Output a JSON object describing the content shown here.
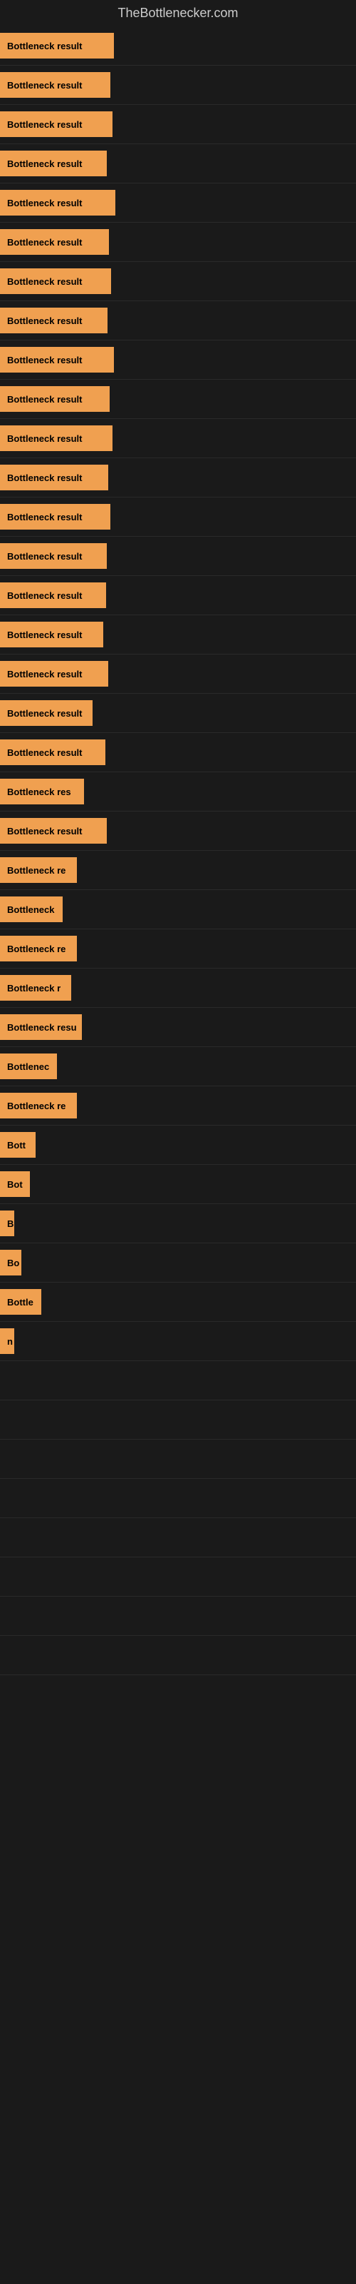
{
  "site": {
    "title": "TheBottlenecker.com"
  },
  "bars": [
    {
      "label": "Bottleneck result",
      "width": 160
    },
    {
      "label": "Bottleneck result",
      "width": 155
    },
    {
      "label": "Bottleneck result",
      "width": 158
    },
    {
      "label": "Bottleneck result",
      "width": 150
    },
    {
      "label": "Bottleneck result",
      "width": 162
    },
    {
      "label": "Bottleneck result",
      "width": 153
    },
    {
      "label": "Bottleneck result",
      "width": 156
    },
    {
      "label": "Bottleneck result",
      "width": 151
    },
    {
      "label": "Bottleneck result",
      "width": 160
    },
    {
      "label": "Bottleneck result",
      "width": 154
    },
    {
      "label": "Bottleneck result",
      "width": 158
    },
    {
      "label": "Bottleneck result",
      "width": 152
    },
    {
      "label": "Bottleneck result",
      "width": 155
    },
    {
      "label": "Bottleneck result",
      "width": 150
    },
    {
      "label": "Bottleneck result",
      "width": 149
    },
    {
      "label": "Bottleneck result",
      "width": 145
    },
    {
      "label": "Bottleneck result",
      "width": 152
    },
    {
      "label": "Bottleneck result",
      "width": 130
    },
    {
      "label": "Bottleneck result",
      "width": 148
    },
    {
      "label": "Bottleneck res",
      "width": 118
    },
    {
      "label": "Bottleneck result",
      "width": 150
    },
    {
      "label": "Bottleneck re",
      "width": 108
    },
    {
      "label": "Bottleneck",
      "width": 88
    },
    {
      "label": "Bottleneck re",
      "width": 108
    },
    {
      "label": "Bottleneck r",
      "width": 100
    },
    {
      "label": "Bottleneck resu",
      "width": 115
    },
    {
      "label": "Bottlenec",
      "width": 80
    },
    {
      "label": "Bottleneck re",
      "width": 108
    },
    {
      "label": "Bott",
      "width": 50
    },
    {
      "label": "Bot",
      "width": 42
    },
    {
      "label": "B",
      "width": 20
    },
    {
      "label": "Bo",
      "width": 30
    },
    {
      "label": "Bottle",
      "width": 58
    },
    {
      "label": "n",
      "width": 14
    },
    {
      "label": "",
      "width": 0
    },
    {
      "label": "",
      "width": 0
    },
    {
      "label": "",
      "width": 0
    },
    {
      "label": "",
      "width": 0
    },
    {
      "label": "",
      "width": 0
    },
    {
      "label": "",
      "width": 0
    },
    {
      "label": "",
      "width": 0
    },
    {
      "label": "",
      "width": 0
    }
  ]
}
